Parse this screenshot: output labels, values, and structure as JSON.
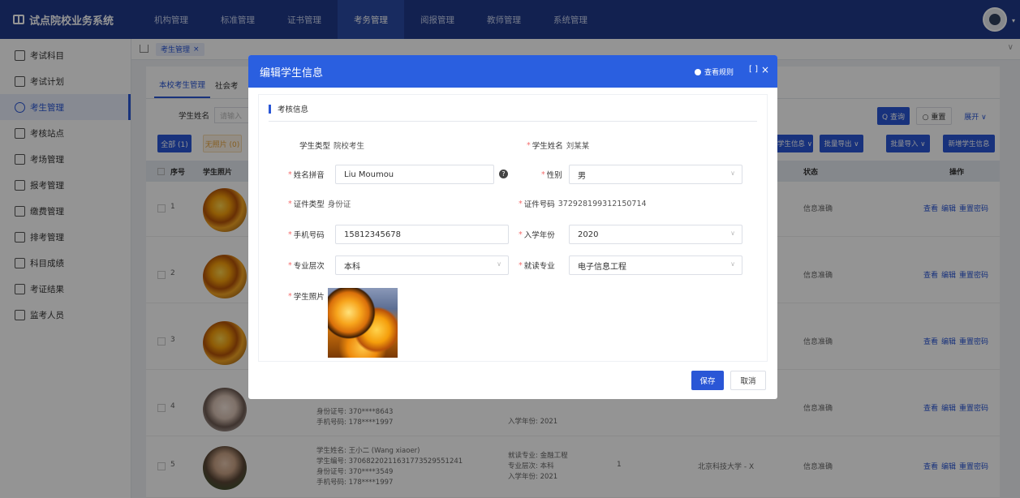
{
  "app": {
    "title": "试点院校业务系统"
  },
  "nav": [
    "机构管理",
    "标准管理",
    "证书管理",
    "考务管理",
    "阅报管理",
    "教师管理",
    "系统管理"
  ],
  "sidebar": [
    "考试科目",
    "考试计划",
    "考生管理",
    "考核站点",
    "考场管理",
    "报考管理",
    "缴费管理",
    "排考管理",
    "科目成绩",
    "考证结果",
    "监考人员"
  ],
  "tag": {
    "label": "考生管理",
    "close": "×"
  },
  "subtabs": [
    "本校考生管理",
    "社会考"
  ],
  "search": {
    "label": "学生姓名",
    "placeholder": "请输入"
  },
  "buttons": {
    "query": "Q 查询",
    "reset": "○ 重置",
    "expand": "展开 ∨",
    "all": "全部 (1)",
    "nophoto": "无照片 (0)",
    "export_info": "导出学生信息 ∨",
    "batch_export": "批量导出 ∨",
    "batch_import": "批量导入 ∨",
    "add_student": "新增学生信息"
  },
  "table": {
    "headers": {
      "index": "序号",
      "photo": "学生照片",
      "status": "状态",
      "ops": "操作"
    },
    "rows": [
      {
        "idx": "1",
        "info": [],
        "major": [],
        "count": "",
        "school": "",
        "status": "信息准确"
      },
      {
        "idx": "2",
        "info": [],
        "major": [],
        "count": "",
        "school": "",
        "status": "信息准确"
      },
      {
        "idx": "3",
        "info": [],
        "major": [],
        "count": "",
        "school": "",
        "status": "信息准确"
      },
      {
        "idx": "4",
        "info": [
          "身份证号: 370****8643",
          "手机号码: 178****1997"
        ],
        "major": [
          "入学年份: 2021"
        ],
        "count": "",
        "school": "",
        "status": "信息准确"
      },
      {
        "idx": "5",
        "info": [
          "学生姓名: 王小二 (Wang xiaoer)",
          "学生编号: 37068220211631773529551241",
          "身份证号: 370****3549",
          "手机号码: 178****1997"
        ],
        "major": [
          "就读专业: 金融工程",
          "专业层次: 本科",
          "入学年份: 2021"
        ],
        "count": "1",
        "school": "北京科技大学 - X",
        "status": "信息准确"
      }
    ],
    "ops": [
      "查看",
      "编辑",
      "重置密码"
    ]
  },
  "dialog": {
    "title": "编辑学生信息",
    "rules": "查看规则",
    "fullscreen": "[ ]",
    "close": "×",
    "section": "考核信息",
    "fields": {
      "type_label": "学生类型",
      "type_value": "院校考生",
      "name_label": "学生姓名",
      "name_value": "刘某某",
      "pinyin_label": "姓名拼音",
      "pinyin_value": "Liu Moumou",
      "gender_label": "性别",
      "gender_value": "男",
      "idtype_label": "证件类型",
      "idtype_value": "身份证",
      "idno_label": "证件号码",
      "idno_value": "372928199312150714",
      "phone_label": "手机号码",
      "phone_value": "15812345678",
      "year_label": "入学年份",
      "year_value": "2020",
      "level_label": "专业层次",
      "level_value": "本科",
      "major_label": "就读专业",
      "major_value": "电子信息工程",
      "photo_label": "学生照片"
    },
    "save": "保存",
    "cancel": "取消"
  },
  "colors": {
    "brand": "#1f3a8a",
    "accent": "#2a56d6",
    "required": "#f56c6c"
  }
}
